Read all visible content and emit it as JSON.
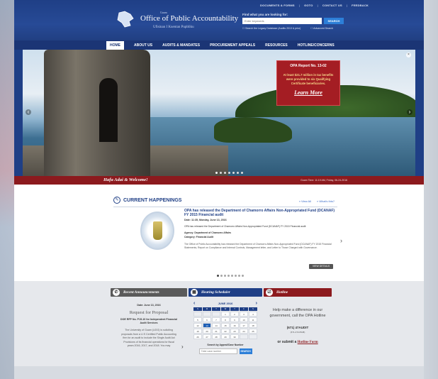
{
  "top_links": [
    "DOCUMENTS & FORMS",
    "GOTO",
    "CONTACT US",
    "FEEDBACK"
  ],
  "brand": {
    "small": "Guam",
    "title": "Office of Public Accountability",
    "subtitle": "Ufisinan I Kuentan Pupbliku"
  },
  "search": {
    "label": "Find what you are looking for:",
    "placeholder": "Enter keywords",
    "button": "SEARCH",
    "option1": "Search the Legacy Database (Audits 2013 & prior)",
    "option2": "Advanced Search"
  },
  "nav": {
    "items": [
      "HOME",
      "ABOUT US",
      "AUDITS & MANDATES",
      "PROCUREMENT APPEALS",
      "RESOURCES",
      "HOTLINE/CONCERNS"
    ]
  },
  "hero": {
    "report_title": "OPA Report No. 13-02",
    "report_text": "At least $21.7 million in tax benefits were provided to six Qualifying Certificate beneficiaries.",
    "report_link": "Learn More",
    "slide_count": 7,
    "active_slide": 0
  },
  "welcome": {
    "text": "Hafa Adai & Welcome!",
    "guam_time": "Guam Time: 11:19 AM, Friday, 06-24-2016"
  },
  "happenings": {
    "title": "CURRENT HAPPENINGS",
    "view_all": "» View All",
    "whats_this": "» What's this?",
    "headline": "OPA has released the Department of Chamorro Affairs Non-Appropriated Fund (DCANAF) FY 2015 Financial audit",
    "date": "Date: 11:35, Monday, June 13, 2016",
    "line1": "OPA has released the Department of Chamorro Affairs Non-Appropriated Fund (DCANAF) FY 2015 Financial audit",
    "line2": "Agency: Department of Chamorro Affairs",
    "line3": "Category: Financial Audit",
    "line4": "The Office of Public Accountability has released the Department of Chamorro Affairs Non-Appropriated Fund (DCANAF) FY 2015 Financial Statements, Report on Compliance and Internal Controls, Management letter, and Letter to Those Charged with Governance.",
    "view_details": "VIEW DETAILS",
    "dot_count": 8
  },
  "announcements": {
    "title": "Recent Announcements",
    "date": "Date: June 13, 2016",
    "rfp": "Request for Proposal",
    "doe": "DOE RFP No. P15-10 for Independent Financial Audit Services",
    "body": "The University of Guam (UOG) is soliciting proposals from a U.S Certified Public Accounting firm for an audit to include the Single Audit Act Provisions of its financial operations for fiscal years 2016, 2017, and 2018. You may"
  },
  "hearing": {
    "title": "Hearing Scheduler",
    "month": "JUNE 2016",
    "dow": [
      "S",
      "M",
      "T",
      "W",
      "T",
      "F",
      "S"
    ],
    "days": [
      "",
      "",
      "",
      "1",
      "2",
      "3",
      "4",
      "5",
      "6",
      "7",
      "8",
      "9",
      "10",
      "11",
      "12",
      "13",
      "14",
      "15",
      "16",
      "17",
      "18",
      "19",
      "20",
      "21",
      "22",
      "23",
      "24",
      "25",
      "26",
      "27",
      "28",
      "29",
      "30",
      "",
      ""
    ],
    "selected_day": "13",
    "case_label": "Search by Appeal/Case Number",
    "case_placeholder": "Enter case number",
    "case_button": "SEARCH"
  },
  "hotline": {
    "title": "Hotline",
    "text": "Help make a difference in our government, call the OPA Hotline",
    "phone": "(671) 47AUDIT",
    "phone_alt": "(671-472-8348)",
    "submit_prefix": "or submit a",
    "submit_link": "Hotline Form"
  }
}
